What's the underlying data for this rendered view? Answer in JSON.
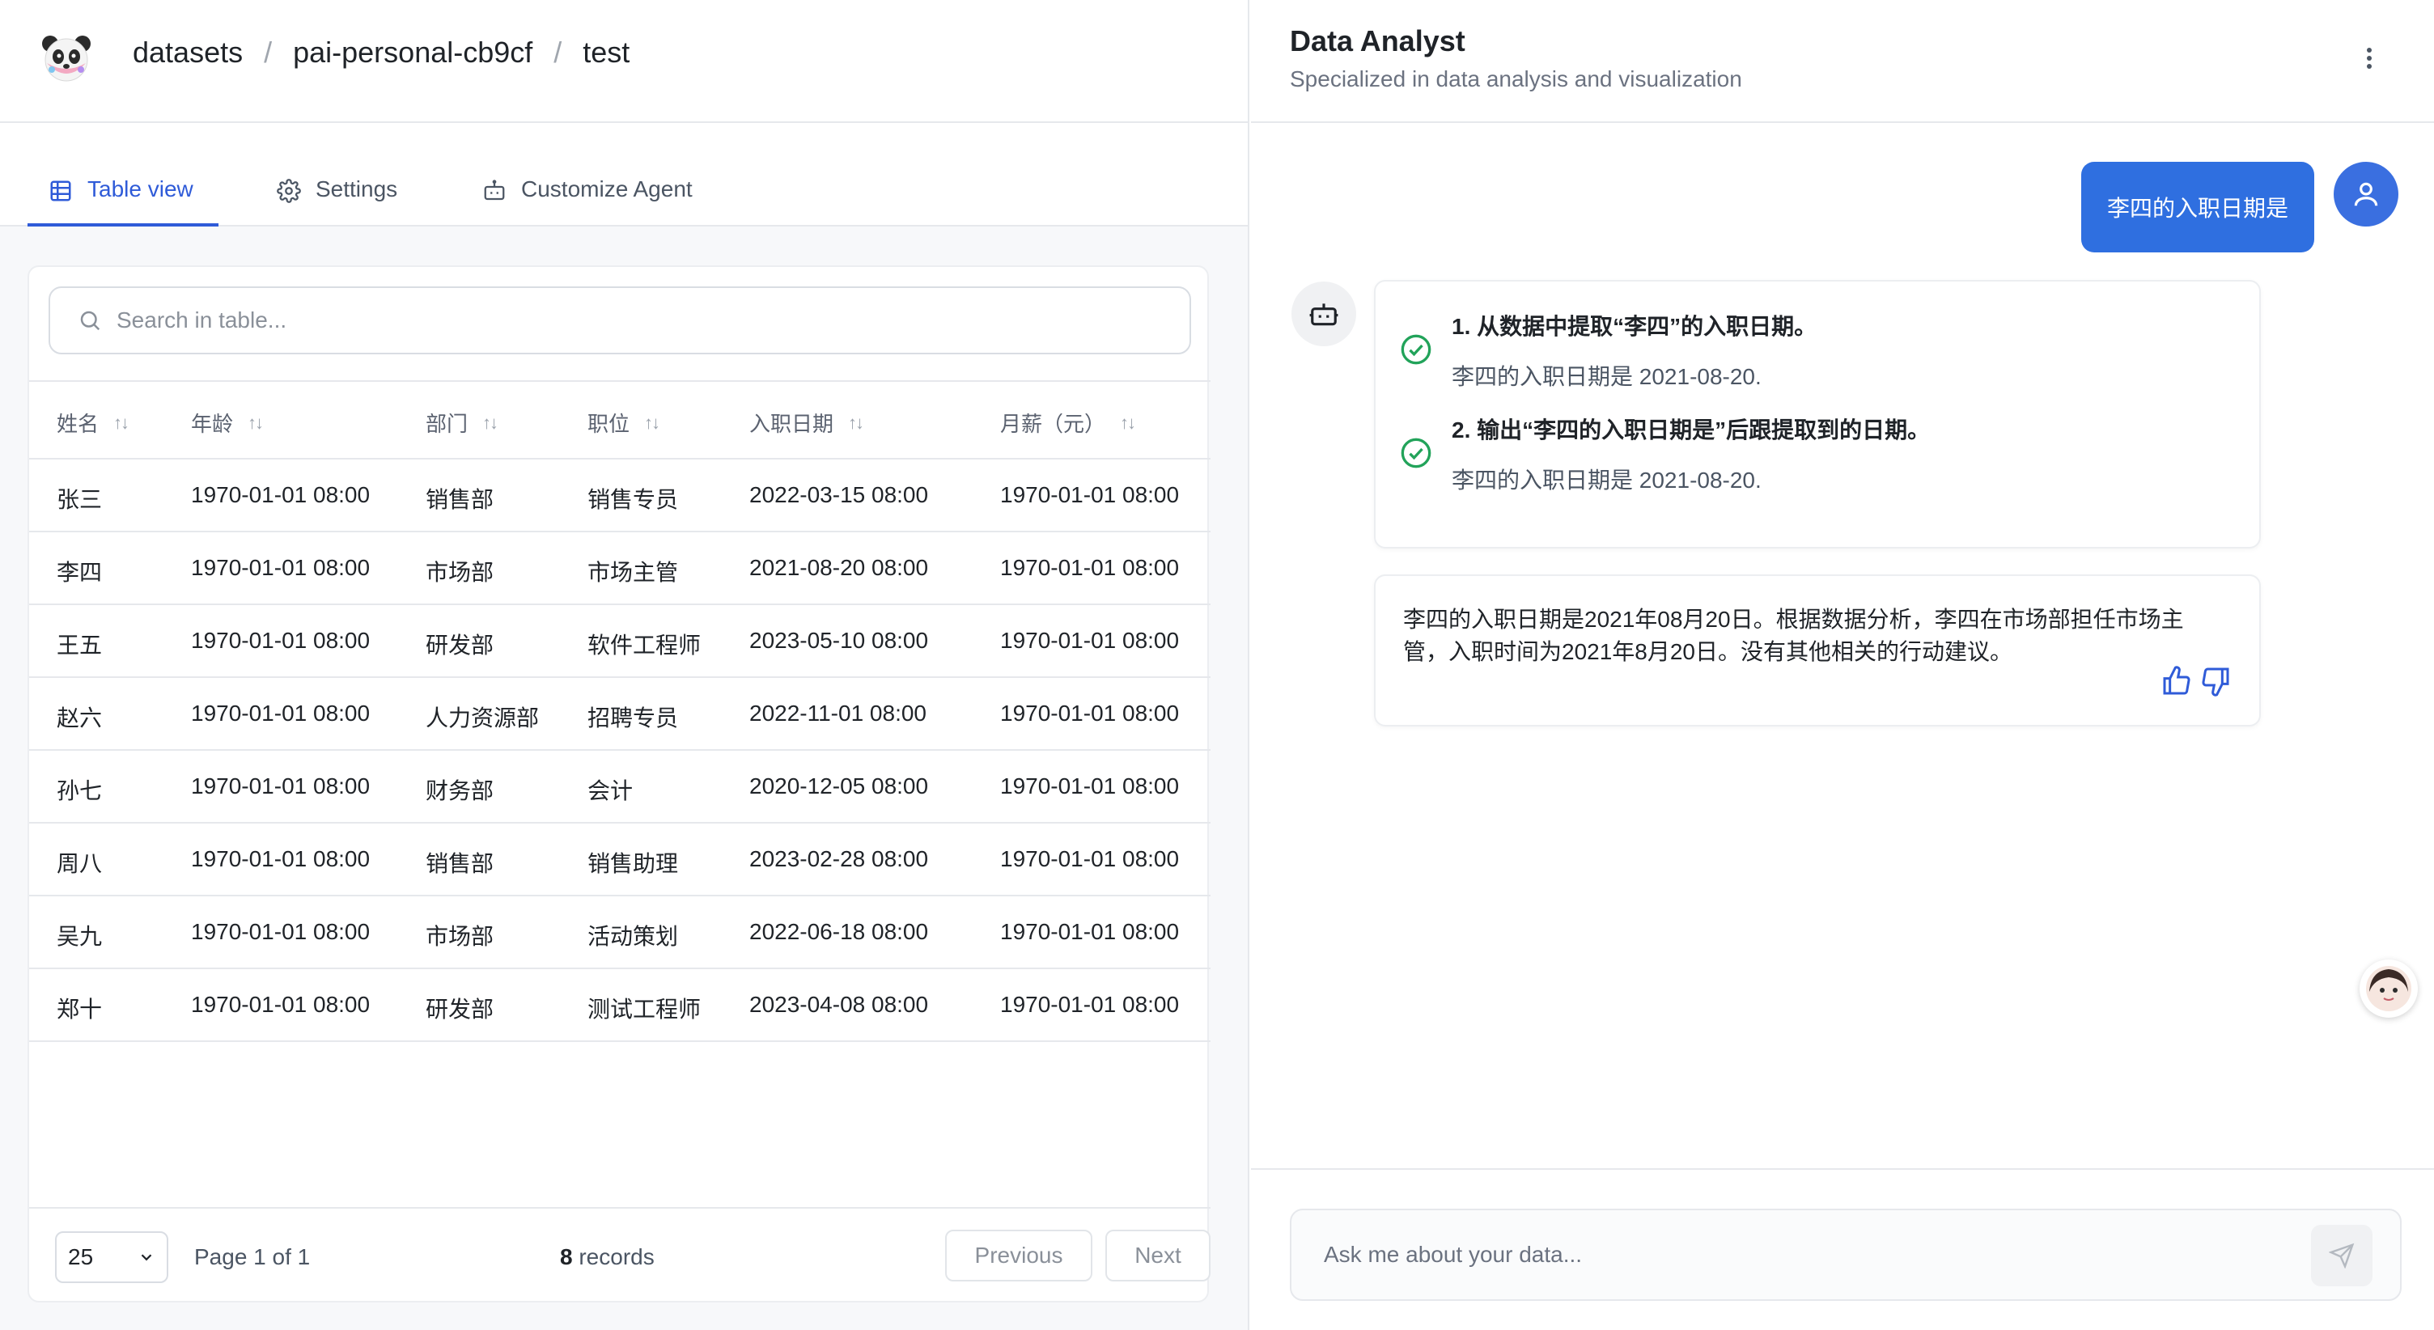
{
  "breadcrumb": {
    "root": "datasets",
    "project": "pai-personal-cb9cf",
    "dataset": "test",
    "separator": "/"
  },
  "tabs": [
    {
      "label": "Table view",
      "icon": "table-icon",
      "active": true
    },
    {
      "label": "Settings",
      "icon": "gear-icon",
      "active": false
    },
    {
      "label": "Customize Agent",
      "icon": "robot-icon",
      "active": false
    }
  ],
  "table": {
    "search_placeholder": "Search in table...",
    "columns": [
      "姓名",
      "年龄",
      "部门",
      "职位",
      "入职日期",
      "月薪（元）"
    ],
    "rows": [
      [
        "张三",
        "1970-01-01 08:00",
        "销售部",
        "销售专员",
        "2022-03-15 08:00",
        "1970-01-01 08:00"
      ],
      [
        "李四",
        "1970-01-01 08:00",
        "市场部",
        "市场主管",
        "2021-08-20 08:00",
        "1970-01-01 08:00"
      ],
      [
        "王五",
        "1970-01-01 08:00",
        "研发部",
        "软件工程师",
        "2023-05-10 08:00",
        "1970-01-01 08:00"
      ],
      [
        "赵六",
        "1970-01-01 08:00",
        "人力资源部",
        "招聘专员",
        "2022-11-01 08:00",
        "1970-01-01 08:00"
      ],
      [
        "孙七",
        "1970-01-01 08:00",
        "财务部",
        "会计",
        "2020-12-05 08:00",
        "1970-01-01 08:00"
      ],
      [
        "周八",
        "1970-01-01 08:00",
        "销售部",
        "销售助理",
        "2023-02-28 08:00",
        "1970-01-01 08:00"
      ],
      [
        "吴九",
        "1970-01-01 08:00",
        "市场部",
        "活动策划",
        "2022-06-18 08:00",
        "1970-01-01 08:00"
      ],
      [
        "郑十",
        "1970-01-01 08:00",
        "研发部",
        "测试工程师",
        "2023-04-08 08:00",
        "1970-01-01 08:00"
      ]
    ]
  },
  "pagination": {
    "page_size": "25",
    "page_info": "Page 1 of 1",
    "record_count": "8",
    "records_label": "records",
    "previous_label": "Previous",
    "next_label": "Next"
  },
  "agent": {
    "title": "Data Analyst",
    "subtitle": "Specialized in data analysis and visualization"
  },
  "chat": {
    "user_message": "李四的入职日期是",
    "steps": [
      {
        "title": "1. 从数据中提取“李四”的入职日期。",
        "result": "李四的入职日期是 2021-08-20."
      },
      {
        "title": "2. 输出“李四的入职日期是”后跟提取到的日期。",
        "result": "李四的入职日期是 2021-08-20."
      }
    ],
    "answer": "李四的入职日期是2021年08月20日。根据数据分析，李四在市场部担任市场主管，入职时间为2021年8月20日。没有其他相关的行动建议。",
    "input_placeholder": "Ask me about your data..."
  },
  "colors": {
    "accent": "#2f5bd8",
    "user_bubble": "#2f6fe0",
    "success": "#22a35a"
  }
}
